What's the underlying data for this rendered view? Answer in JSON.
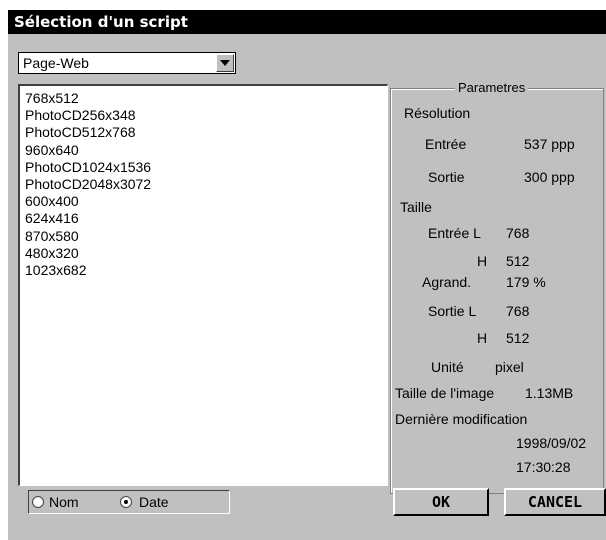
{
  "window": {
    "title": "Sélection d'un script"
  },
  "dropdown": {
    "value": "Page-Web"
  },
  "scripts": [
    "768x512",
    "PhotoCD256x348",
    "PhotoCD512x768",
    "960x640",
    "PhotoCD1024x1536",
    "PhotoCD2048x3072",
    "600x400",
    "624x416",
    "870x580",
    "480x320",
    "1023x682"
  ],
  "params": {
    "legend": "Parametres",
    "resolution": "Résolution",
    "entree_label": "Entrée",
    "entree_value": "537 ppp",
    "sortie_label": "Sortie",
    "sortie_value": "300 ppp",
    "taille": "Taille",
    "entree_l_label": "Entrée L",
    "entree_l_value": "768",
    "h1_label": "H",
    "h1_value": "512",
    "agrand_label": "Agrand.",
    "agrand_value": "179 %",
    "sortie_l_label": "Sortie  L",
    "sortie_l_value": "768",
    "h2_label": "H",
    "h2_value": "512",
    "unite_label": "Unité",
    "unite_value": "pixel",
    "taille_image_label": "Taille de l'image",
    "taille_image_value": "1.13MB",
    "derniere_modif_label": "Dernière modification",
    "date": "1998/09/02",
    "time": "17:30:28"
  },
  "sort": {
    "nom_label": "Nom",
    "date_label": "Date",
    "selected": "Date"
  },
  "buttons": {
    "ok": "OK",
    "cancel": "CANCEL"
  }
}
